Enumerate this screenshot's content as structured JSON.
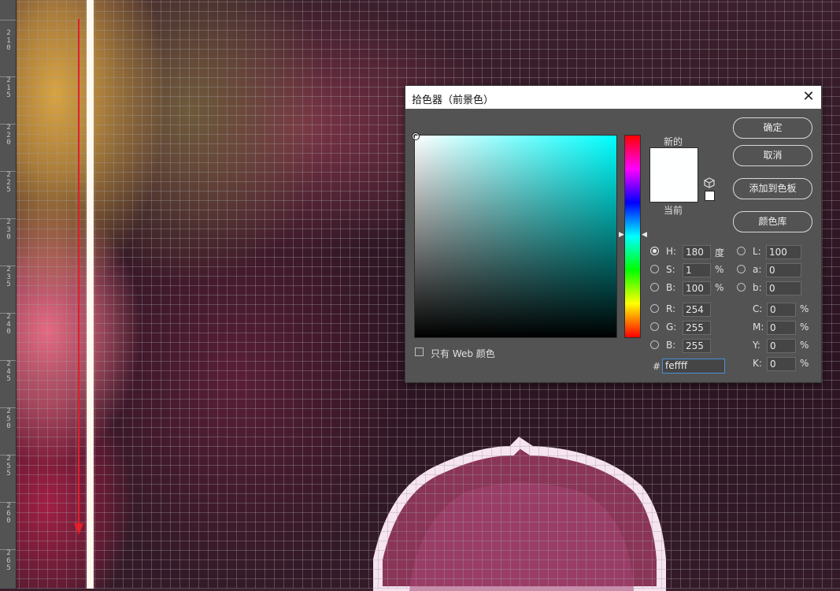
{
  "ruler": {
    "labels": [
      "210",
      "215",
      "220",
      "225",
      "230",
      "235",
      "240",
      "245",
      "250",
      "255",
      "260",
      "265"
    ]
  },
  "dialog": {
    "title": "拾色器（前景色）",
    "close_icon": "close-icon",
    "buttons": {
      "ok": "确定",
      "cancel": "取消",
      "add_to_swatches": "添加到色板",
      "color_libraries": "颜色库"
    },
    "preview": {
      "new_label": "新的",
      "current_label": "当前",
      "new_color": "#feffff",
      "current_color": "#feffff"
    },
    "hsb": {
      "H": {
        "label": "H:",
        "value": "180",
        "unit": "度",
        "selected": true
      },
      "S": {
        "label": "S:",
        "value": "1",
        "unit": "%"
      },
      "B": {
        "label": "B:",
        "value": "100",
        "unit": "%"
      }
    },
    "rgb": {
      "R": {
        "label": "R:",
        "value": "254"
      },
      "G": {
        "label": "G:",
        "value": "255"
      },
      "B": {
        "label": "B:",
        "value": "255"
      }
    },
    "lab": {
      "L": {
        "label": "L:",
        "value": "100"
      },
      "a": {
        "label": "a:",
        "value": "0"
      },
      "b": {
        "label": "b:",
        "value": "0"
      }
    },
    "cmyk": {
      "C": {
        "label": "C:",
        "value": "0",
        "unit": "%"
      },
      "M": {
        "label": "M:",
        "value": "0",
        "unit": "%"
      },
      "Y": {
        "label": "Y:",
        "value": "0",
        "unit": "%"
      },
      "K": {
        "label": "K:",
        "value": "0",
        "unit": "%"
      }
    },
    "hex": {
      "prefix": "#",
      "value": "feffff"
    },
    "web_only": {
      "label": "只有 Web 颜色",
      "checked": false
    },
    "hue_field_color": "#00ffff"
  }
}
